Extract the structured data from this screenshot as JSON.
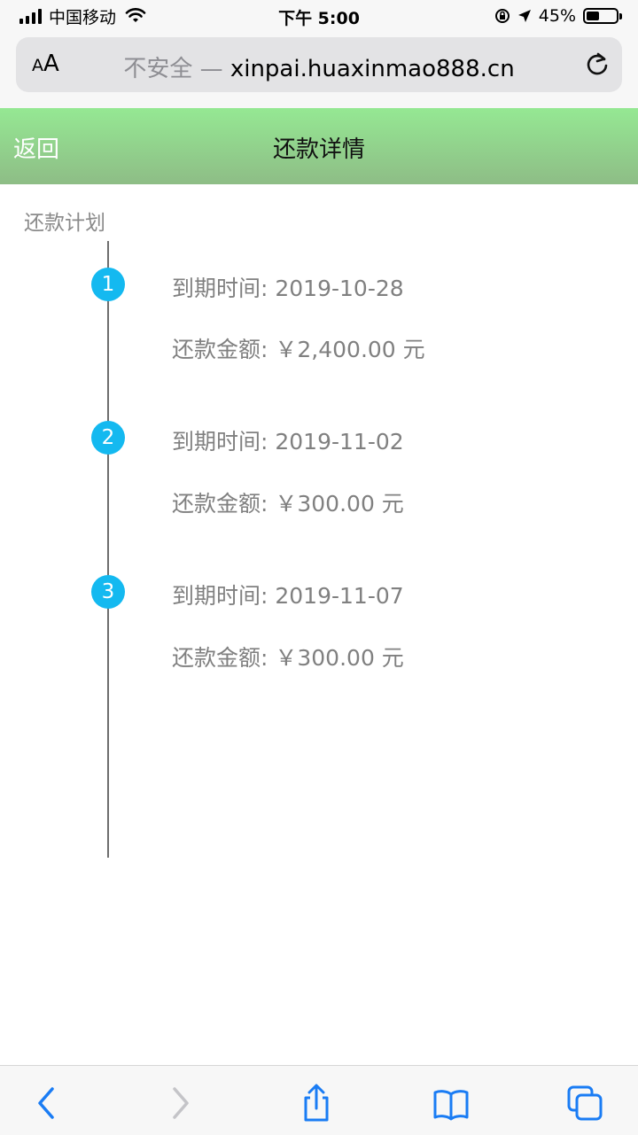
{
  "status_bar": {
    "carrier": "中国移动",
    "time": "下午 5:00",
    "battery_percent": "45%",
    "battery_level": 0.45,
    "icons": [
      "signal-icon",
      "wifi-icon",
      "rotation-lock-icon",
      "location-icon",
      "battery-icon"
    ]
  },
  "browser": {
    "text_size_label": "AA",
    "insecure_label": "不安全 —",
    "domain": "xinpai.huaxinmao888.cn",
    "reload_icon": "reload-icon"
  },
  "header": {
    "back_label": "返回",
    "title": "还款详情",
    "gradient_top": "#95e893",
    "gradient_bottom": "#8ebd86"
  },
  "plan": {
    "section_label": "还款计划",
    "accent": "#14b9f0",
    "items": [
      {
        "index": "1",
        "due": "到期时间: 2019-10-28",
        "amount": "还款金额: ￥2,400.00 元"
      },
      {
        "index": "2",
        "due": "到期时间: 2019-11-02",
        "amount": "还款金额: ￥300.00 元"
      },
      {
        "index": "3",
        "due": "到期时间: 2019-11-07",
        "amount": "还款金额: ￥300.00 元"
      }
    ]
  },
  "toolbar": {
    "icons": [
      "back-arrow-icon",
      "forward-arrow-icon",
      "share-icon",
      "bookmarks-icon",
      "tabs-icon"
    ],
    "tint": "#1a7cf4"
  }
}
